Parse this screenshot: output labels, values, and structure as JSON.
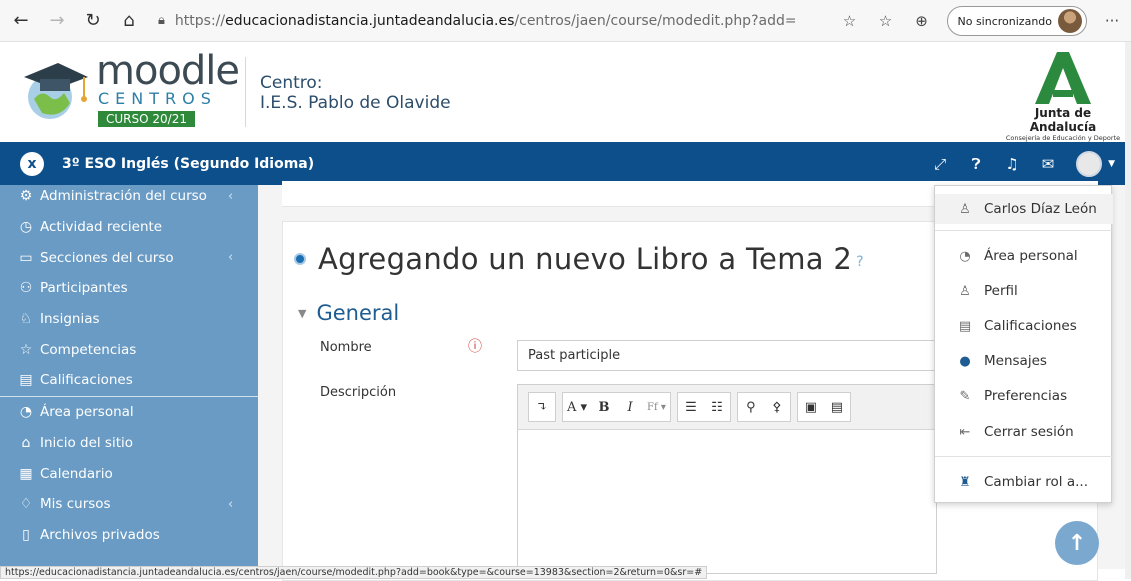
{
  "browser": {
    "url_scheme": "https://",
    "url_host": "educacionadistancia.juntadeandalucia.es",
    "url_path": "/centros/jaen/course/modedit.php?add=book&ty...",
    "sync_label": "No sincronizando",
    "icons": [
      "back-icon",
      "forward-icon",
      "refresh-icon",
      "home-icon",
      "lock-icon",
      "add-favorite-icon",
      "favorites-icon",
      "collections-icon",
      "more-icon"
    ]
  },
  "header": {
    "logo_word": "moodle",
    "logo_sub": "CENTROS",
    "logo_badge": "CURSO 20/21",
    "centro_label": "Centro:",
    "centro_name": "I.E.S. Pablo de Olavide",
    "junta_name": "Junta de Andalucía",
    "junta_sub": "Consejería de Educación y Deporte"
  },
  "navbar": {
    "close_glyph": "x",
    "course_title": "3º ESO Inglés (Segundo Idioma)"
  },
  "sidebar": {
    "items": [
      {
        "label": "Administración del curso",
        "icon": "gears-icon",
        "glyph": "⚙",
        "chevron": true
      },
      {
        "label": "Actividad reciente",
        "icon": "clock-icon",
        "glyph": "◷",
        "chevron": false
      },
      {
        "label": "Secciones del curso",
        "icon": "folder-icon",
        "glyph": "▭",
        "chevron": true
      },
      {
        "label": "Participantes",
        "icon": "users-icon",
        "glyph": "⚇",
        "chevron": false
      },
      {
        "label": "Insignias",
        "icon": "badge-icon",
        "glyph": "♘",
        "chevron": false
      },
      {
        "label": "Competencias",
        "icon": "star-icon",
        "glyph": "☆",
        "chevron": false
      },
      {
        "label": "Calificaciones",
        "icon": "grades-icon",
        "glyph": "▤",
        "chevron": false
      },
      {
        "label": "Área personal",
        "icon": "dashboard-icon",
        "glyph": "◔",
        "chevron": false
      },
      {
        "label": "Inicio del sitio",
        "icon": "home-icon",
        "glyph": "⌂",
        "chevron": false
      },
      {
        "label": "Calendario",
        "icon": "calendar-icon",
        "glyph": "▦",
        "chevron": false
      },
      {
        "label": "Mis cursos",
        "icon": "graduation-cap-icon",
        "glyph": "♢",
        "chevron": true
      },
      {
        "label": "Archivos privados",
        "icon": "files-icon",
        "glyph": "▯",
        "chevron": false
      }
    ]
  },
  "main": {
    "page_title": "Agregando un nuevo Libro a Tema 2",
    "section_title": "General",
    "name_label": "Nombre",
    "name_value": "Past participle",
    "description_label": "Descripción"
  },
  "editor_toolbar": {
    "buttons": [
      "↴",
      "A ▾",
      "B",
      "I",
      "Ff ▾",
      "☰",
      "☷",
      "⚲",
      "⚴",
      "▣",
      "▤"
    ]
  },
  "user_menu": {
    "items": [
      {
        "label": "Carlos Díaz León",
        "icon": "user-icon",
        "glyph": "♙"
      },
      {
        "label": "Área personal",
        "icon": "dashboard-icon",
        "glyph": "◔"
      },
      {
        "label": "Perfil",
        "icon": "profile-icon",
        "glyph": "♙"
      },
      {
        "label": "Calificaciones",
        "icon": "grades-icon",
        "glyph": "▤"
      },
      {
        "label": "Mensajes",
        "icon": "message-icon",
        "glyph": "●"
      },
      {
        "label": "Preferencias",
        "icon": "wrench-icon",
        "glyph": "✎"
      },
      {
        "label": "Cerrar sesión",
        "icon": "logout-icon",
        "glyph": "⇤"
      },
      {
        "label": "Cambiar rol a...",
        "icon": "role-icon",
        "glyph": "♜"
      }
    ]
  },
  "statusbar": {
    "text": "https://educacionadistancia.juntadeandalucia.es/centros/jaen/course/modedit.php?add=book&type=&course=13983&section=2&return=0&sr=#"
  },
  "colors": {
    "navbar": "#0c4f8b",
    "sidebar": "#6a9bc4",
    "accent": "#1e5c91",
    "required": "#d03a3a"
  }
}
